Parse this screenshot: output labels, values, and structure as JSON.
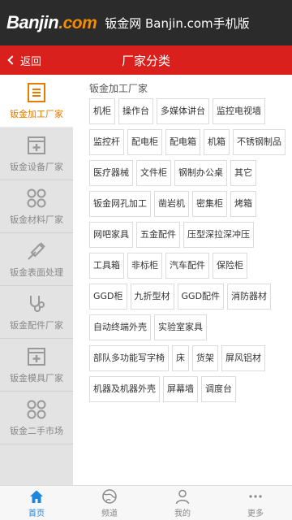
{
  "brand": {
    "logo_part1": "Banjin",
    "logo_part2": ".com",
    "subtitle": "钣金网 Banjin.com手机版"
  },
  "header": {
    "back_label": "返回",
    "title": "厂家分类"
  },
  "sidebar": {
    "items": [
      {
        "label": "钣金加工厂家",
        "icon": "list-icon",
        "active": true
      },
      {
        "label": "钣金设备厂家",
        "icon": "plus-box-icon",
        "active": false
      },
      {
        "label": "钣金材料厂家",
        "icon": "grid-circles-icon",
        "active": false
      },
      {
        "label": "钣金表面处理",
        "icon": "spray-gun-icon",
        "active": false
      },
      {
        "label": "钣金配件厂家",
        "icon": "stethoscope-icon",
        "active": false
      },
      {
        "label": "钣金模具厂家",
        "icon": "plus-box-icon",
        "active": false
      },
      {
        "label": "钣金二手市场",
        "icon": "grid-circles-icon",
        "active": false
      }
    ]
  },
  "main": {
    "section_title": "钣金加工厂家",
    "tags": [
      "机柜",
      "操作台",
      "多媒体讲台",
      "监控电视墙",
      "监控杆",
      "配电柜",
      "配电箱",
      "机箱",
      "不锈钢制品",
      "医疗器械",
      "文件柜",
      "钢制办公桌",
      "其它",
      "钣金网孔加工",
      "凿岩机",
      "密集柜",
      "烤箱",
      "网吧家具",
      "五金配件",
      "压型深拉深冲压",
      "工具箱",
      "非标柜",
      "汽车配件",
      "保险柜",
      "GGD柜",
      "九折型材",
      "GGD配件",
      "消防器材",
      "自动终端外壳",
      "实验室家具",
      "部队多功能写字椅",
      "床",
      "货架",
      "屏风铝材",
      "机器及机器外壳",
      "屏幕墙",
      "调度台"
    ]
  },
  "tabbar": {
    "items": [
      {
        "label": "首页",
        "icon": "home-icon",
        "active": true
      },
      {
        "label": "频道",
        "icon": "globe-icon",
        "active": false
      },
      {
        "label": "我的",
        "icon": "user-icon",
        "active": false
      },
      {
        "label": "更多",
        "icon": "more-dots-icon",
        "active": false
      }
    ]
  },
  "colors": {
    "brand_bar": "#2b2b2b",
    "header_red": "#d9201c",
    "accent_orange": "#e57c00",
    "tab_active_blue": "#1c86e0"
  }
}
